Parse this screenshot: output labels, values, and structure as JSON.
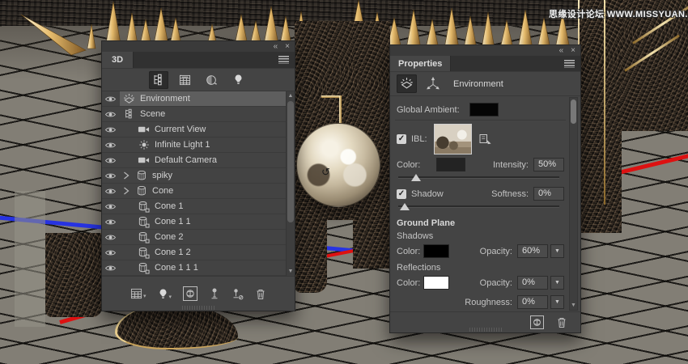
{
  "watermark": "思缘设计论坛 WWW.MISSYUAN.COM",
  "colors": {
    "panel_background": "#444444",
    "selected_row": "#5e5e5e",
    "axis_x_red": "#dd1111",
    "axis_z_blue": "#2733e2",
    "gold_spike": "#e6bc6d"
  },
  "panel3d": {
    "tab": "3D",
    "filter_icons": [
      "scene-filter",
      "meshes-filter",
      "materials-filter",
      "lights-filter"
    ],
    "rows": [
      {
        "label": "Environment",
        "icon": "environment",
        "indent": 0,
        "arrow": false,
        "selected": true
      },
      {
        "label": "Scene",
        "icon": "scene",
        "indent": 0,
        "arrow": false,
        "selected": false
      },
      {
        "label": "Current View",
        "icon": "camera",
        "indent": 1,
        "arrow": false,
        "selected": false
      },
      {
        "label": "Infinite Light 1",
        "icon": "light",
        "indent": 1,
        "arrow": false,
        "selected": false
      },
      {
        "label": "Default Camera",
        "icon": "camera",
        "indent": 1,
        "arrow": false,
        "selected": false
      },
      {
        "label": "spiky",
        "icon": "mesh",
        "indent": 0,
        "arrow": true,
        "selected": false
      },
      {
        "label": "Cone",
        "icon": "mesh",
        "indent": 0,
        "arrow": true,
        "selected": false
      },
      {
        "label": "Cone 1",
        "icon": "meshsub",
        "indent": 1,
        "arrow": false,
        "selected": false
      },
      {
        "label": "Cone 1 1",
        "icon": "meshsub",
        "indent": 1,
        "arrow": false,
        "selected": false
      },
      {
        "label": "Cone 2",
        "icon": "meshsub",
        "indent": 1,
        "arrow": false,
        "selected": false
      },
      {
        "label": "Cone 1 2",
        "icon": "meshsub",
        "indent": 1,
        "arrow": false,
        "selected": false
      },
      {
        "label": "Cone 1 1 1",
        "icon": "meshsub",
        "indent": 1,
        "arrow": false,
        "selected": false
      }
    ]
  },
  "properties": {
    "tab": "Properties",
    "panel_title": "Environment",
    "global_ambient_label": "Global Ambient:",
    "ibl_label": "IBL:",
    "ibl_checked": true,
    "color_label": "Color:",
    "intensity_label": "Intensity:",
    "intensity_value": "50%",
    "shadow_label": "Shadow",
    "shadow_checked": true,
    "softness_label": "Softness:",
    "softness_value": "0%",
    "ground": {
      "title": "Ground Plane",
      "shadows_label": "Shadows",
      "color_label": "Color:",
      "opacity_label": "Opacity:",
      "shadow_opacity_value": "60%",
      "reflections_label": "Reflections",
      "reflection_opacity_value": "0%",
      "roughness_label": "Roughness:",
      "roughness_value": "0%"
    },
    "swatches": {
      "global_ambient": "#050505",
      "ibl_color": "#232323",
      "ground_shadow": "#000000",
      "ground_reflection": "#ffffff"
    }
  }
}
